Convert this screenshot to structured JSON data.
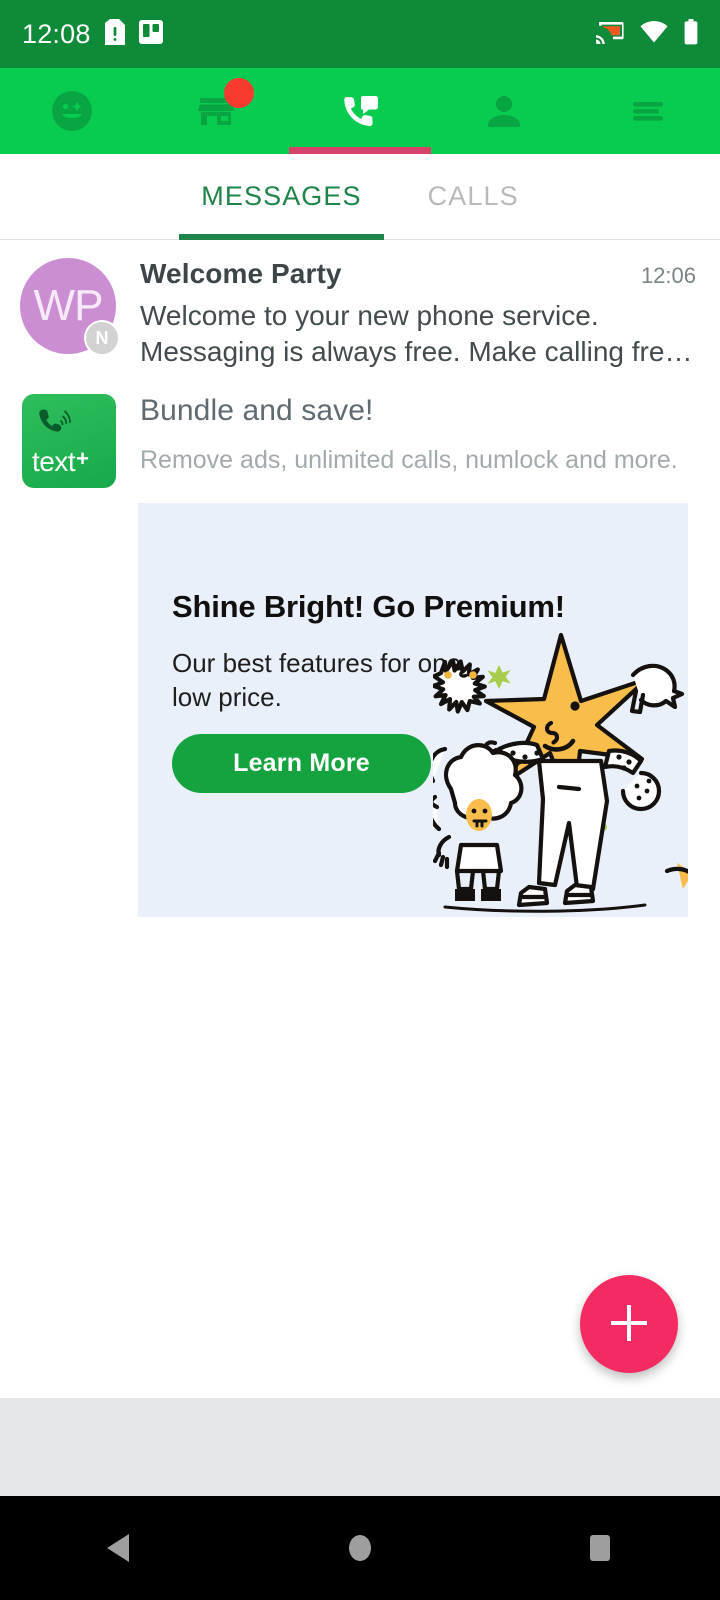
{
  "status_bar": {
    "time": "12:08",
    "icons_left": [
      "sim-card-alert-icon",
      "trello-notification-icon"
    ],
    "icons_right": [
      "cast-icon",
      "wifi-icon",
      "battery-icon"
    ],
    "background": "#0f8a38"
  },
  "top_nav": {
    "background": "#07cc50",
    "indicator_color": "#d6436a",
    "items": [
      {
        "name": "smiley-face-icon",
        "label": "Stickers",
        "active": false,
        "badge": false
      },
      {
        "name": "store-icon",
        "label": "Store",
        "active": false,
        "badge": true
      },
      {
        "name": "message-phone-icon",
        "label": "Messages",
        "active": true,
        "badge": false
      },
      {
        "name": "person-icon",
        "label": "Contacts",
        "active": false,
        "badge": false
      },
      {
        "name": "hamburger-menu-icon",
        "label": "Menu",
        "active": false,
        "badge": false
      }
    ],
    "badge_color": "#f93a2f"
  },
  "tabs": {
    "active_color": "#1e8449",
    "inactive_color": "#b9b9b9",
    "items": [
      {
        "label": "MESSAGES",
        "active": true
      },
      {
        "label": "CALLS",
        "active": false
      }
    ]
  },
  "conversation": {
    "avatar_initials": "WP",
    "avatar_color": "#cc8ed2",
    "avatar_badge": "N",
    "name": "Welcome Party",
    "time": "12:06",
    "preview": "Welcome to your new phone service. Messaging is always free. Make calling fre…"
  },
  "bundle_promo": {
    "logo_word": "text",
    "logo_plus": "+",
    "title": "Bundle and save!",
    "subtitle": "Remove ads, unlimited calls, numlock and more."
  },
  "ad_card": {
    "background": "#e9f0f9",
    "title": "Shine Bright! Go Premium!",
    "subtitle": "Our best features for one low price.",
    "cta_label": "Learn More",
    "cta_color": "#14a33f",
    "art": "star-character-illustration"
  },
  "fab": {
    "icon": "plus-icon",
    "color": "#f42a62",
    "label": "New message"
  },
  "bottom_bar": {
    "background": "#e4e6e7"
  },
  "system_nav": {
    "background": "#000000",
    "buttons": [
      "back-button",
      "home-button",
      "recents-button"
    ]
  }
}
